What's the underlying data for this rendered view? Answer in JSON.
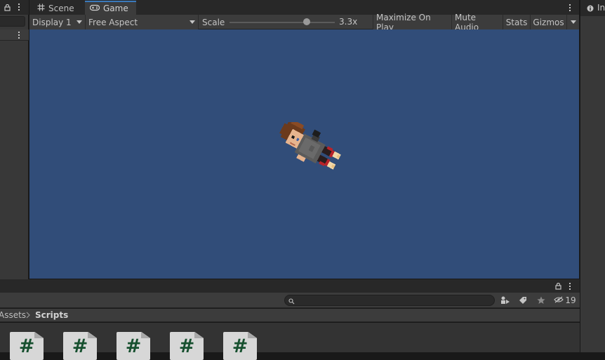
{
  "tabs": [
    {
      "label": "Scene",
      "icon": "grid-icon"
    },
    {
      "label": "Game",
      "icon": "gamepad-icon",
      "active": true
    }
  ],
  "game_toolbar": {
    "display": "Display 1",
    "aspect": "Free Aspect",
    "scale_label": "Scale",
    "scale_value": "3.3x",
    "scale_fraction": 0.73,
    "maximize": "Maximize On Play",
    "mute": "Mute Audio",
    "stats": "Stats",
    "gizmos": "Gizmos"
  },
  "inspector": {
    "tab_label": "In"
  },
  "project": {
    "breadcrumb": [
      "Assets",
      "Scripts"
    ],
    "search_value": "",
    "hidden_count": "19",
    "scripts": [
      "#",
      "#",
      "#",
      "#",
      "#"
    ]
  },
  "colors": {
    "game_background": "#314d79",
    "accent": "#3a79bb",
    "script_hash": "#17502f"
  }
}
